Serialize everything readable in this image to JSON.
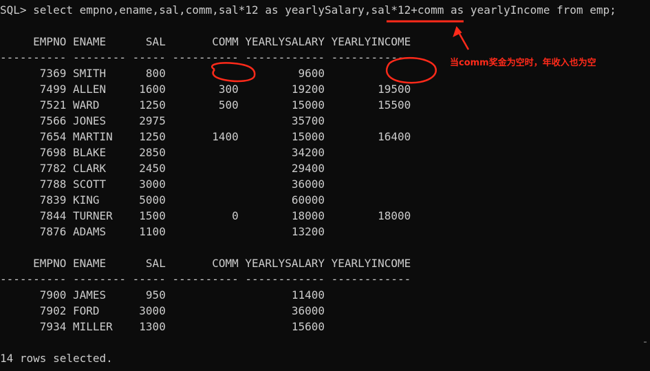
{
  "terminal": {
    "prompt": "SQL> select empno,ename,sal,comm,sal*12 as yearlySalary,sal*12+comm as yearlyIncome from emp;",
    "header": "     EMPNO ENAME      SAL       COMM YEARLYSALARY YEARLYINCOME",
    "separator": "---------- -------- ----- ---------- ------------ ------------",
    "page1_rows": [
      "      7369 SMITH      800                    9600",
      "      7499 ALLEN     1600        300        19200        19500",
      "      7521 WARD      1250        500        15000        15500",
      "      7566 JONES     2975                   35700",
      "      7654 MARTIN    1250       1400        15000        16400",
      "      7698 BLAKE     2850                   34200",
      "      7782 CLARK     2450                   29400",
      "      7788 SCOTT     3000                   36000",
      "      7839 KING      5000                   60000",
      "      7844 TURNER    1500          0        18000        18000",
      "      7876 ADAMS     1100                   13200"
    ],
    "page2_rows": [
      "      7900 JAMES      950                   11400",
      "      7902 FORD      3000                   36000",
      "      7934 MILLER    1300                   15600"
    ],
    "footer": "14 rows selected."
  },
  "annotation": {
    "note": "当comm奖金为空时，年收入也为空",
    "color": "#ff2a1a"
  }
}
